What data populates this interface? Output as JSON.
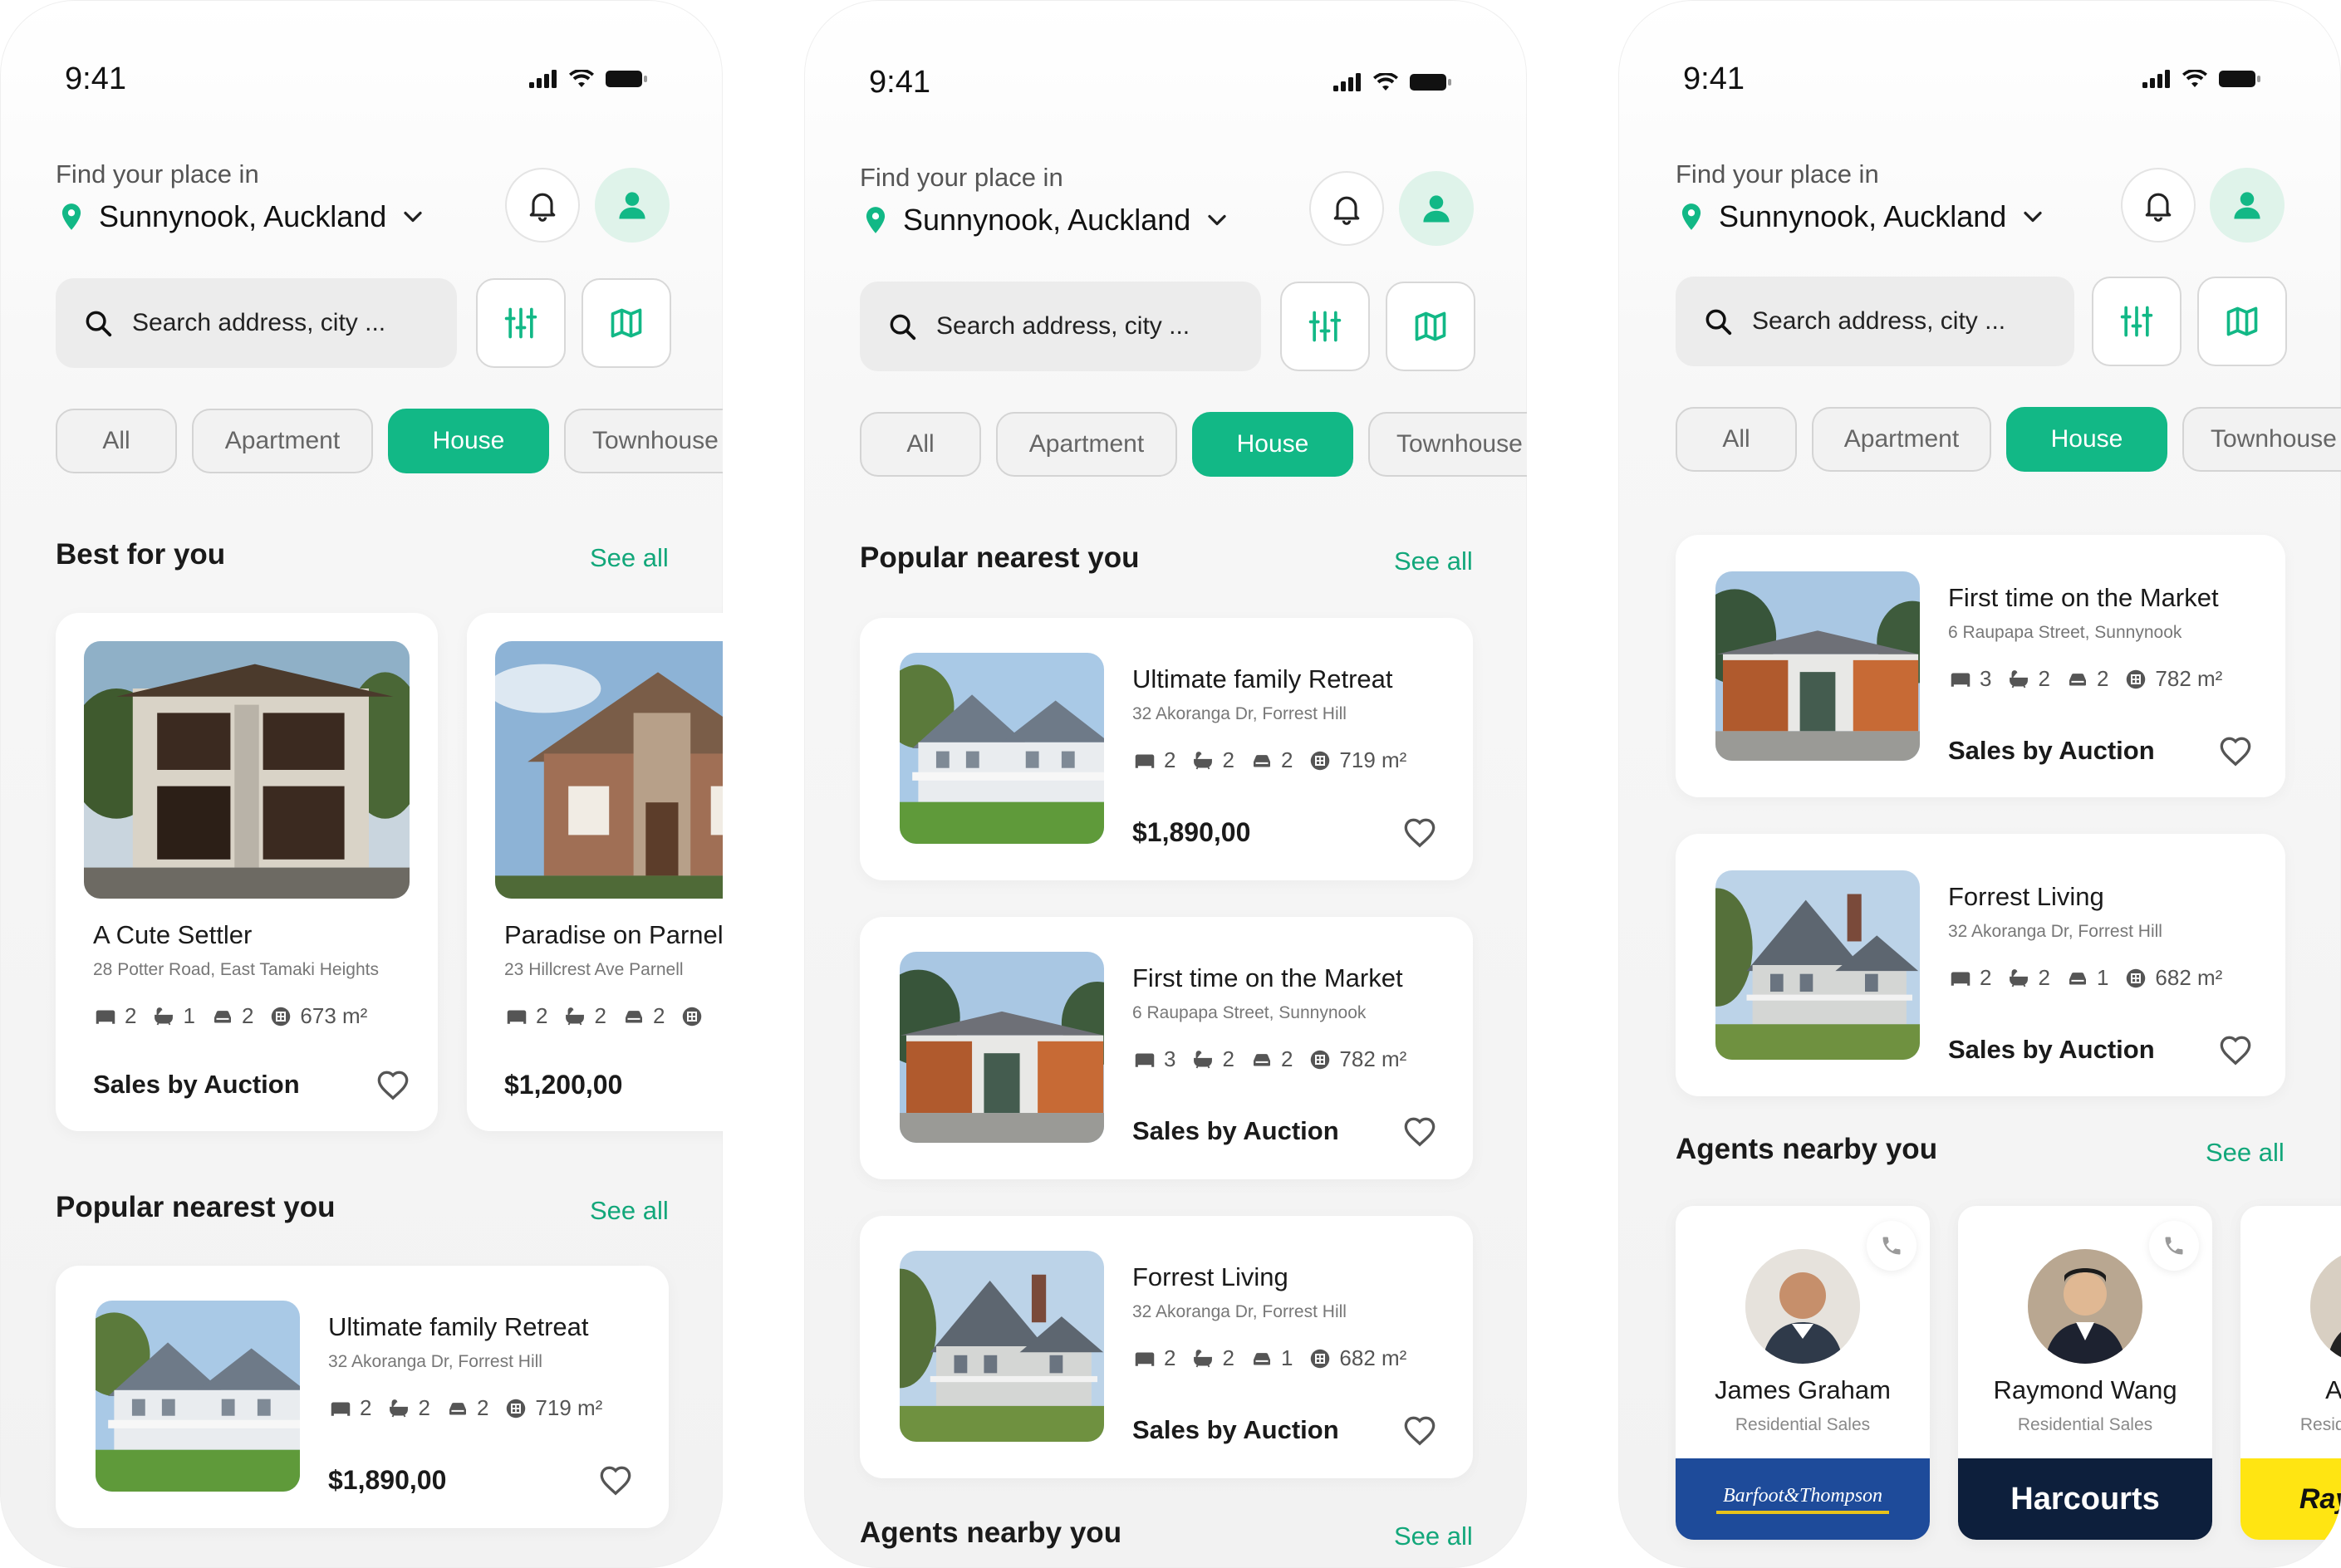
{
  "status": {
    "time": "9:41"
  },
  "header": {
    "find_label": "Find your place in",
    "location": "Sunnynook, Auckland"
  },
  "search": {
    "placeholder": "Search address, city ..."
  },
  "filters": [
    "All",
    "Apartment",
    "House",
    "Townhouse"
  ],
  "active_filter": "House",
  "colors": {
    "accent": "#12B886",
    "accent_light": "#DFF3EA",
    "background": "#F2F2F2"
  },
  "icons": {
    "notification": "bell-icon",
    "profile": "user-icon",
    "filter": "sliders-icon",
    "map": "map-icon",
    "location": "location-pin-icon",
    "dropdown": "chevron-down-icon",
    "search": "search-icon",
    "bed": "bed-icon",
    "bath": "bath-icon",
    "garage": "car-icon",
    "area": "area-icon",
    "favorite": "heart-icon",
    "call": "phone-icon"
  },
  "sections": {
    "best_for_you": "Best for you",
    "popular_nearest": "Popular nearest you",
    "agents_nearby": "Agents nearby you",
    "see_all": "See all"
  },
  "best_for_you": [
    {
      "title": "A Cute Settler",
      "address": "28 Potter Road, East Tamaki Heights",
      "beds": "2",
      "baths": "1",
      "garages": "2",
      "area": "673 m²",
      "footer": "Sales by Auction"
    },
    {
      "title": "Paradise on Parnell",
      "address": "23 Hillcrest Ave Parnell",
      "beds": "2",
      "baths": "2",
      "garages": "2",
      "area": "",
      "footer": "$1,200,00"
    }
  ],
  "listings": {
    "retreat": {
      "title": "Ultimate family Retreat",
      "address": "32 Akoranga Dr, Forrest Hill",
      "beds": "2",
      "baths": "2",
      "garages": "2",
      "area": "719 m²",
      "footer": "$1,890,00"
    },
    "market": {
      "title": "First time on the Market",
      "address": "6 Raupapa Street, Sunnynook",
      "beds": "3",
      "baths": "2",
      "garages": "2",
      "area": "782 m²",
      "footer": "Sales by Auction"
    },
    "forrest": {
      "title": "Forrest Living",
      "address": "32 Akoranga Dr, Forrest Hill",
      "beds": "2",
      "baths": "2",
      "garages": "1",
      "area": "682 m²",
      "footer": "Sales by Auction"
    }
  },
  "agents": [
    {
      "name": "James Graham",
      "role": "Residential Sales",
      "agency": "Barfoot&Thompson",
      "brand_color": "#1E4B9A"
    },
    {
      "name": "Raymond Wang",
      "role": "Residential Sales",
      "agency": "Harcourts",
      "brand_color": "#0D1F3C"
    },
    {
      "name": "Akshay",
      "role": "Residential Sales",
      "agency": "Ray White",
      "brand_color": "#FFE512"
    }
  ]
}
